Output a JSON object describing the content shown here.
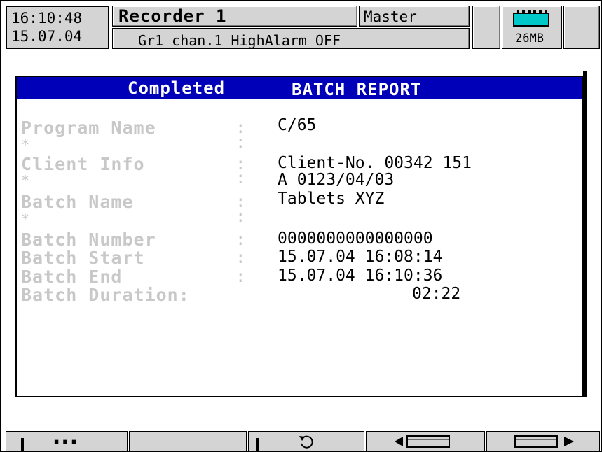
{
  "header": {
    "time": "16:10:48",
    "date": "15.07.04",
    "recorder_title": "Recorder 1",
    "mode": "Master",
    "status_message": "Gr1 chan.1 HighAlarm OFF",
    "memory": "26MB",
    "battery_icon": "memory-card-icon"
  },
  "dialog": {
    "title_status": "Completed",
    "title_main": "BATCH REPORT",
    "rows": [
      {
        "label": "Program Name",
        "colon": ":",
        "value": "C/65"
      },
      {
        "label": "*",
        "colon": ":",
        "value": ""
      },
      {
        "label": "Client Info",
        "colon": ":",
        "value": "Client-No. 00342 151"
      },
      {
        "label": "*",
        "colon": ":",
        "value": "A 0123/04/03"
      },
      {
        "label": "Batch Name",
        "colon": ":",
        "value": "Tablets XYZ"
      },
      {
        "label": "*",
        "colon": ":",
        "value": ""
      },
      {
        "label": "Batch Number",
        "colon": ":",
        "value": "0000000000000000"
      },
      {
        "label": "Batch Start",
        "colon": ":",
        "value": "15.07.04 16:08:14"
      },
      {
        "label": "Batch End",
        "colon": ":",
        "value": "15.07.04 16:10:36"
      },
      {
        "label": "Batch Duration:",
        "colon": "",
        "value": "02:22"
      }
    ]
  },
  "softkeys": {
    "key1": "▪▪▪",
    "key2": "",
    "key3_icon": "rotate-icon",
    "key4_icon": "scroll-left-icon",
    "key5_icon": "scroll-right-icon"
  },
  "colors": {
    "titlebar": "#0000b8",
    "panel": "#d4d4d4",
    "label_gray": "#c8c8c8"
  }
}
